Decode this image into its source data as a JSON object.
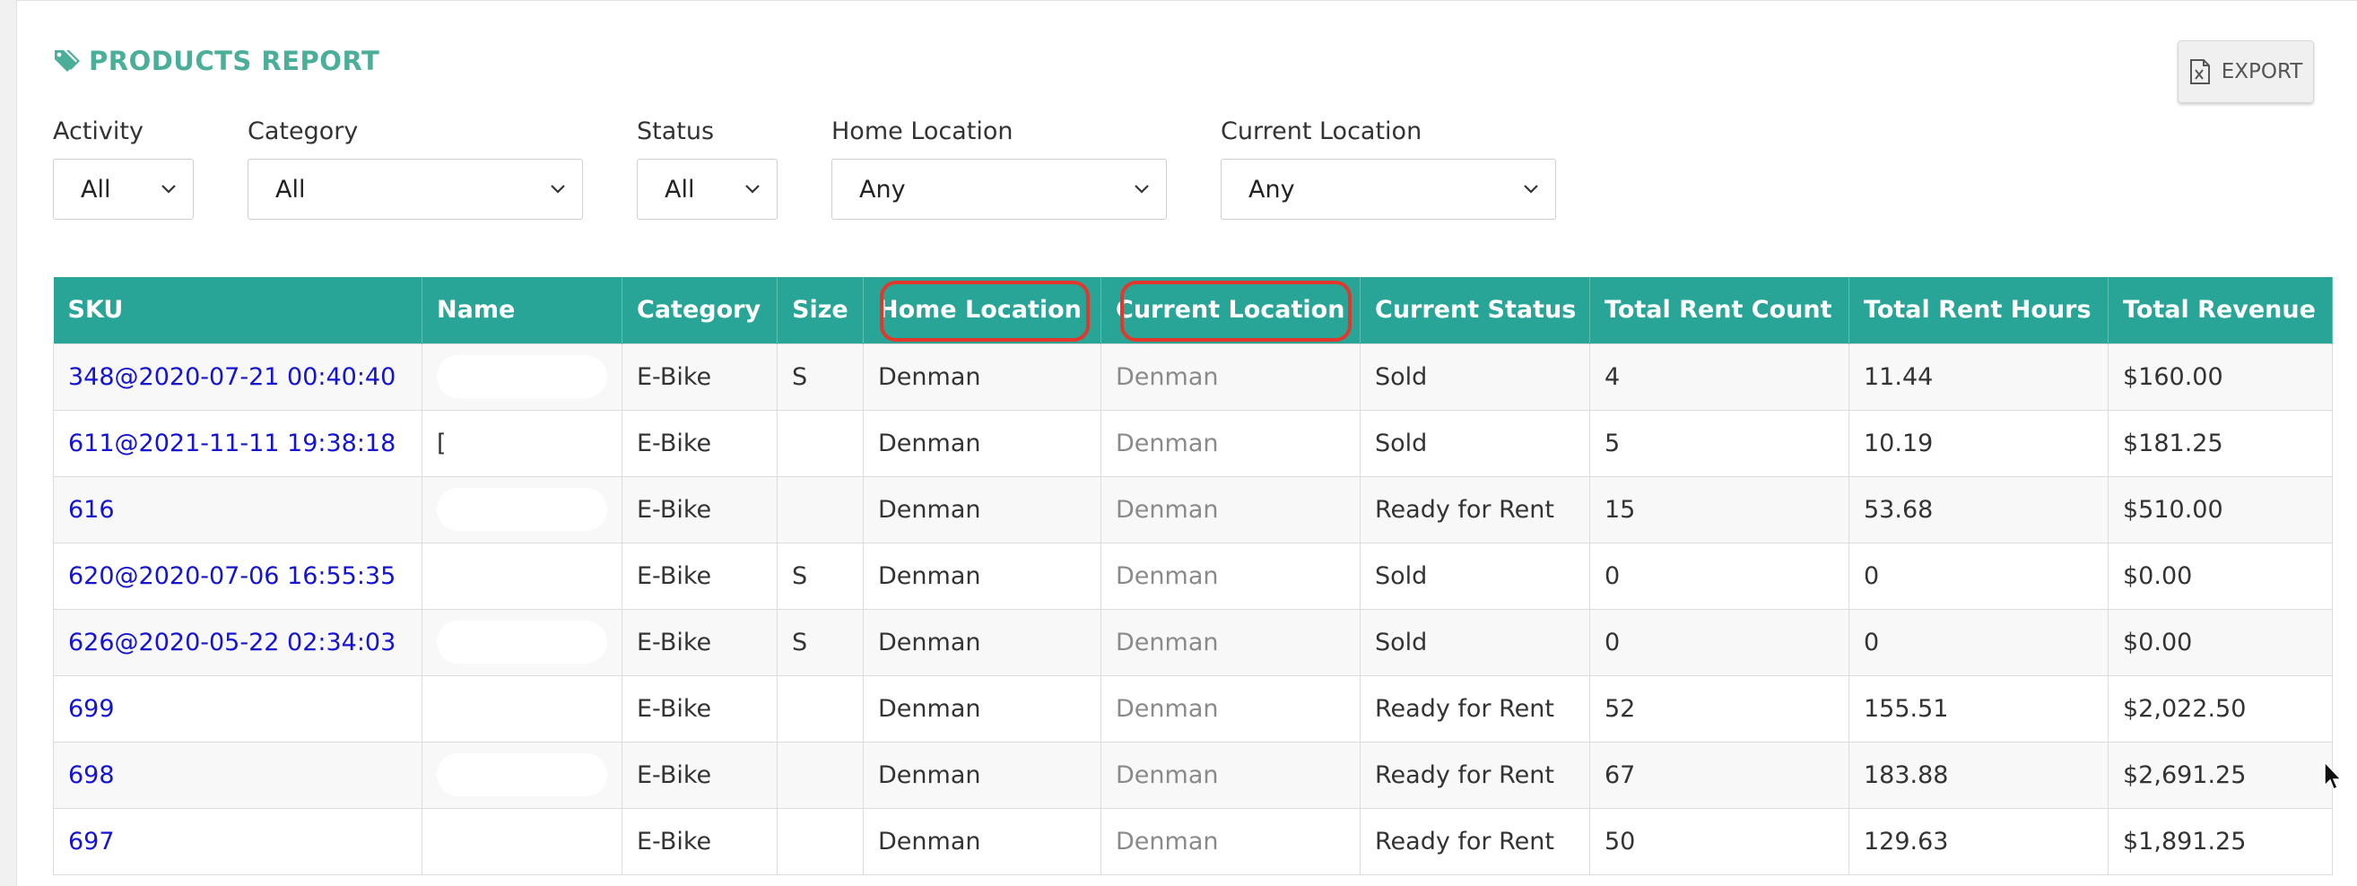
{
  "report": {
    "title": "PRODUCTS REPORT",
    "export_label": "EXPORT",
    "accent_color": "#4bae99",
    "header_color": "#28a596"
  },
  "filters": {
    "activity": {
      "label": "Activity",
      "value": "All"
    },
    "category": {
      "label": "Category",
      "value": "All"
    },
    "status": {
      "label": "Status",
      "value": "All"
    },
    "home_location": {
      "label": "Home Location",
      "value": "Any"
    },
    "current_location": {
      "label": "Current Location",
      "value": "Any"
    }
  },
  "table": {
    "columns": [
      "SKU",
      "Name",
      "Category",
      "Size",
      "Home Location",
      "Current Location",
      "Current Status",
      "Total Rent Count",
      "Total Rent Hours",
      "Total Revenue"
    ],
    "rows": [
      {
        "sku": "348@2020-07-21 00:40:40",
        "name": "",
        "category": "E-Bike",
        "size": "S",
        "home": "Denman",
        "current": "Denman",
        "status": "Sold",
        "count": "4",
        "hours": "11.44",
        "revenue": "$160.00"
      },
      {
        "sku": "611@2021-11-11 19:38:18",
        "name": "[",
        "category": "E-Bike",
        "size": "",
        "home": "Denman",
        "current": "Denman",
        "status": "Sold",
        "count": "5",
        "hours": "10.19",
        "revenue": "$181.25"
      },
      {
        "sku": "616",
        "name": "",
        "category": "E-Bike",
        "size": "",
        "home": "Denman",
        "current": "Denman",
        "status": "Ready for Rent",
        "count": "15",
        "hours": "53.68",
        "revenue": "$510.00"
      },
      {
        "sku": "620@2020-07-06 16:55:35",
        "name": "",
        "category": "E-Bike",
        "size": "S",
        "home": "Denman",
        "current": "Denman",
        "status": "Sold",
        "count": "0",
        "hours": "0",
        "revenue": "$0.00"
      },
      {
        "sku": "626@2020-05-22 02:34:03",
        "name": "",
        "category": "E-Bike",
        "size": "S",
        "home": "Denman",
        "current": "Denman",
        "status": "Sold",
        "count": "0",
        "hours": "0",
        "revenue": "$0.00"
      },
      {
        "sku": "699",
        "name": "",
        "category": "E-Bike",
        "size": "",
        "home": "Denman",
        "current": "Denman",
        "status": "Ready for Rent",
        "count": "52",
        "hours": "155.51",
        "revenue": "$2,022.50"
      },
      {
        "sku": "698",
        "name": "",
        "category": "E-Bike",
        "size": "",
        "home": "Denman",
        "current": "Denman",
        "status": "Ready for Rent",
        "count": "67",
        "hours": "183.88",
        "revenue": "$2,691.25"
      },
      {
        "sku": "697",
        "name": "",
        "category": "E-Bike",
        "size": "",
        "home": "Denman",
        "current": "Denman",
        "status": "Ready for Rent",
        "count": "50",
        "hours": "129.63",
        "revenue": "$1,891.25"
      }
    ]
  }
}
